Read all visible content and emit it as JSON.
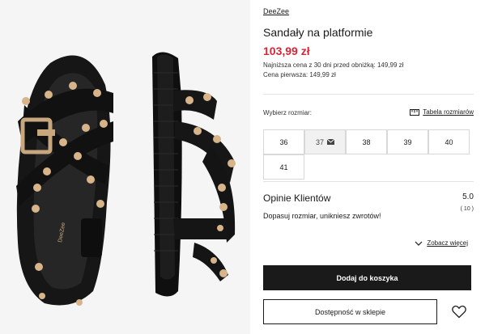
{
  "product": {
    "brand": "DeeZee",
    "title": "Sandały na platformie",
    "price": "103,99 zł",
    "lowest_price": "Najniższa cena z 30 dni przed obniżką: 149,99 zł",
    "first_price": "Cena pierwsza: 149,99 zł",
    "insole_logo": "DeeZee"
  },
  "sizes": {
    "label": "Wybierz rozmiar:",
    "chart_link": "Tabela rozmiarów",
    "options": [
      {
        "label": "36",
        "available": true
      },
      {
        "label": "37",
        "available": false
      },
      {
        "label": "38",
        "available": true
      },
      {
        "label": "39",
        "available": true
      },
      {
        "label": "40",
        "available": true
      },
      {
        "label": "41",
        "available": true
      }
    ]
  },
  "reviews": {
    "title": "Opinie Klientów",
    "rating": "5.0",
    "count": "( 10 )",
    "tip": "Dopasuj rozmiar, unikniesz zwrotów!",
    "see_more": "Zobacz więcej"
  },
  "actions": {
    "add_to_cart": "Dodaj do koszyka",
    "store_availability": "Dostępność w sklepie"
  },
  "colors": {
    "price": "#d4283a",
    "primary_button": "#1a1a1a",
    "stud": "#d8b48a"
  }
}
